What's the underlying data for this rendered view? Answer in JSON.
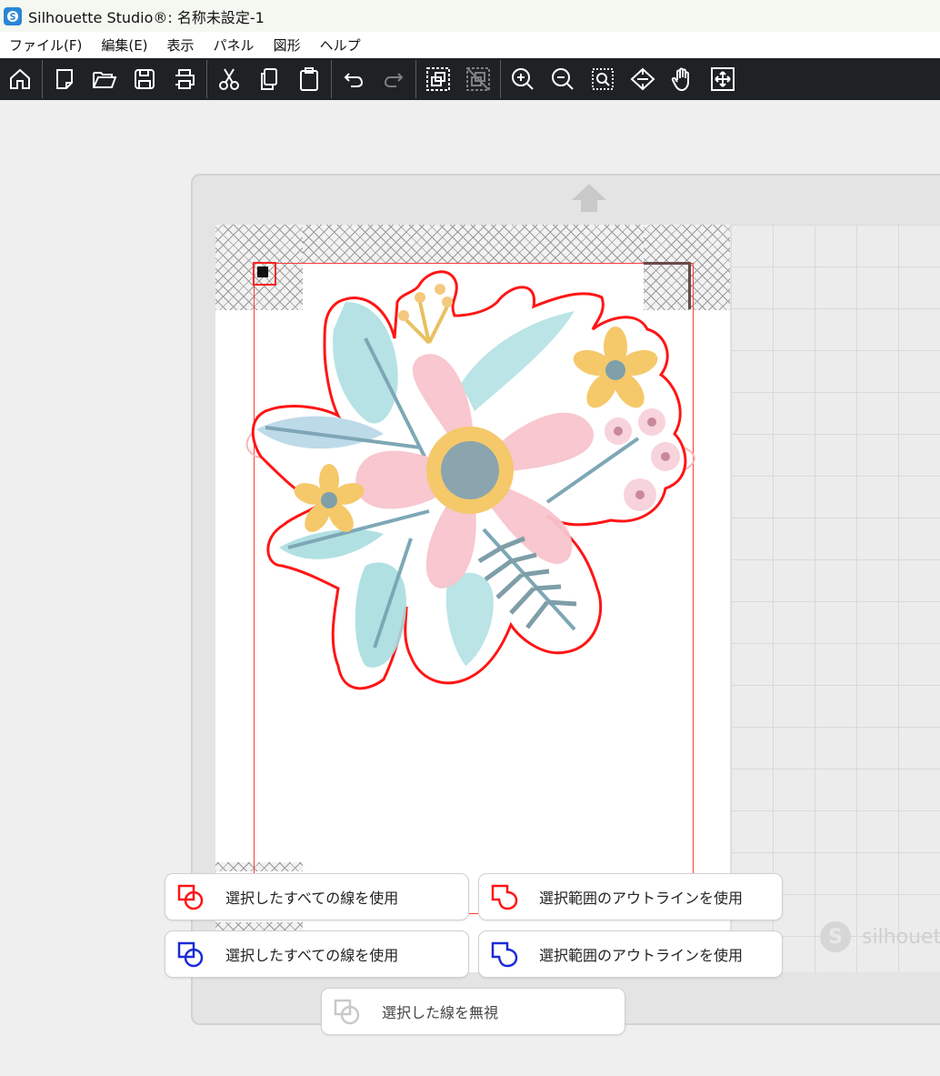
{
  "window": {
    "title": "Silhouette Studio®: 名称未設定-1"
  },
  "menu": [
    "ファイル(F)",
    "編集(E)",
    "表示",
    "パネル",
    "図形",
    "ヘルプ"
  ],
  "toolbar": [
    {
      "icon": "home-icon"
    },
    {
      "icon": "new-document-icon"
    },
    {
      "icon": "open-folder-icon"
    },
    {
      "icon": "save-icon"
    },
    {
      "icon": "print-icon"
    },
    {
      "icon": "cut-icon"
    },
    {
      "icon": "copy-icon"
    },
    {
      "icon": "paste-icon"
    },
    {
      "icon": "undo-icon"
    },
    {
      "icon": "redo-icon"
    },
    {
      "icon": "group-icon"
    },
    {
      "icon": "ungroup-icon"
    },
    {
      "icon": "zoom-in-icon"
    },
    {
      "icon": "zoom-out-icon"
    },
    {
      "icon": "zoom-selection-icon"
    },
    {
      "icon": "fit-to-mat-icon"
    },
    {
      "icon": "pan-hand-icon"
    },
    {
      "icon": "fit-to-page-icon"
    }
  ],
  "options": {
    "red_all_lines": "選択したすべての線を使用",
    "red_outline": "選択範囲のアウトラインを使用",
    "blue_all_lines": "選択したすべての線を使用",
    "blue_outline": "選択範囲のアウトラインを使用",
    "ignore_lines": "選択した線を無視"
  },
  "watermark": "silhouette",
  "colors": {
    "cut_red": "#ff2020",
    "cut_blue": "#1a2bd6",
    "toolbar_bg": "#1f2224"
  }
}
